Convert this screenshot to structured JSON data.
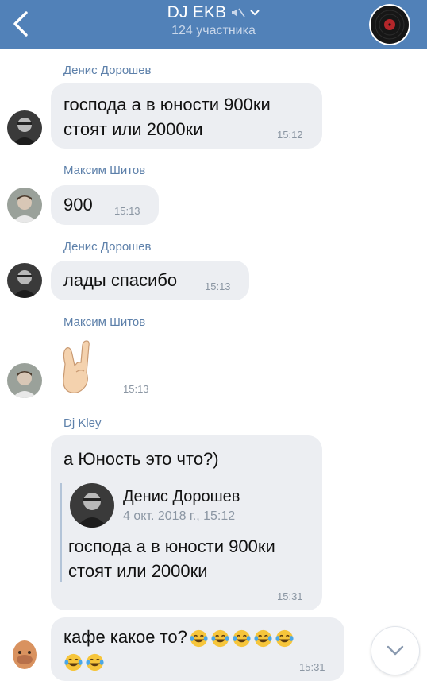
{
  "header": {
    "title": "DJ EKB",
    "subtitle": "124 участника"
  },
  "messages": [
    {
      "sender": "Денис Дорошев",
      "lines": [
        "господа а в юности 900ки",
        "стоят или 2000ки"
      ],
      "time": "15:12"
    },
    {
      "sender": "Максим Шитов",
      "lines": [
        "900"
      ],
      "time": "15:13"
    },
    {
      "sender": "Денис Дорошев",
      "lines": [
        "лады спасибо"
      ],
      "time": "15:13"
    },
    {
      "sender": "Максим Шитов",
      "sticker": "rock-hand-emoji",
      "time": "15:13"
    },
    {
      "sender": "Dj Kley",
      "lines": [
        "а Юность это что?)"
      ],
      "reply": {
        "name": "Денис Дорошев",
        "date": "4 окт. 2018 г., 15:12",
        "lines": [
          "господа а в юности 900ки",
          "стоят или 2000ки"
        ]
      },
      "time": "15:31"
    },
    {
      "lines": [
        "кафе какое то?"
      ],
      "emoji": "tears-of-joy-emoji",
      "emoji_count": 7,
      "time": "15:31"
    }
  ],
  "colors": {
    "header_bg": "#5181b8",
    "bubble_bg": "#eceef2",
    "sender_name": "#5d80aa",
    "time": "#8b96a3"
  }
}
